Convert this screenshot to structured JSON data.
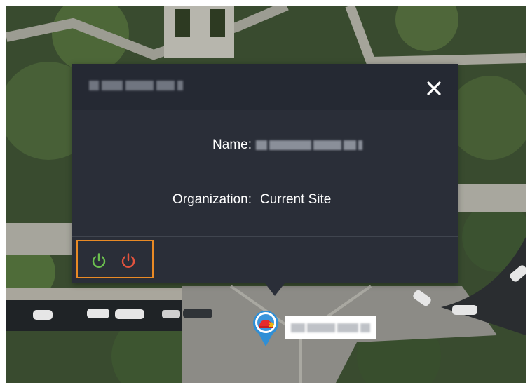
{
  "popup": {
    "title": "",
    "close_icon": "close-icon",
    "fields": [
      {
        "label": "Name:",
        "value": ""
      },
      {
        "label": "Organization:",
        "value": "Current Site"
      }
    ],
    "actions": [
      {
        "name": "power-on",
        "icon": "power-icon",
        "color": "#6bbf4f"
      },
      {
        "name": "power-off",
        "icon": "power-icon",
        "color": "#e2533e"
      }
    ],
    "highlight_color": "#e98a25"
  },
  "map": {
    "marker": {
      "icon": "alarm-light-icon",
      "label": ""
    }
  }
}
